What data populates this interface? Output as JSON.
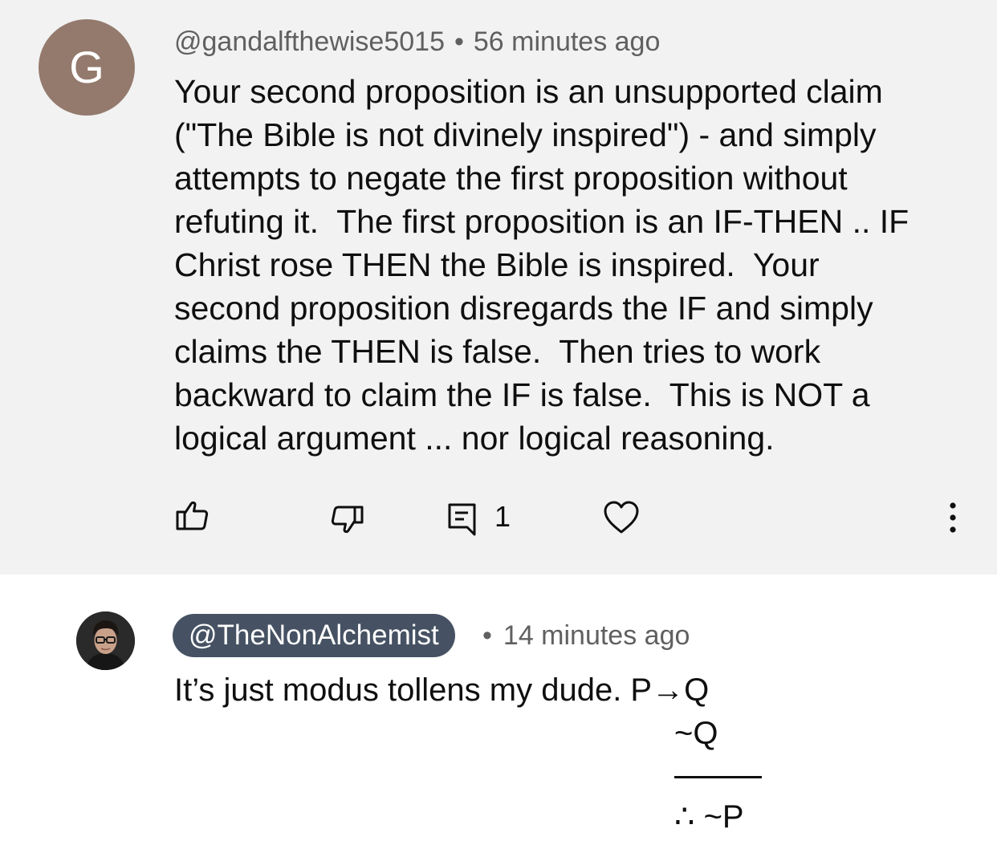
{
  "main_comment": {
    "avatar_letter": "G",
    "author": "@gandalfthewise5015",
    "separator": "•",
    "timestamp": "56 minutes ago",
    "text_lines": [
      "Your second proposition is an unsupported claim",
      "(\"The Bible is not divinely inspired\") - and simply",
      "attempts to negate the first proposition without",
      "refuting it.  The first proposition is an IF-THEN .. IF",
      "Christ rose THEN the Bible is inspired.  Your",
      "second proposition disregards the IF and simply",
      "claims the THEN is false.  Then tries to work",
      "backward to claim the IF is false.  This is NOT a",
      "logical argument ... nor logical reasoning."
    ],
    "actions": {
      "reply_count": "1",
      "like_icon": "thumbs-up-icon",
      "dislike_icon": "thumbs-down-icon",
      "reply_icon": "comment-icon",
      "heart_icon": "heart-icon",
      "more_icon": "more-vertical-icon"
    },
    "avatar_color": "#937a6d",
    "background_color": "#f2f2f2"
  },
  "reply": {
    "author": "@TheNonAlchemist",
    "separator": "•",
    "timestamp": "14 minutes ago",
    "text": "It’s just modus tollens my dude. P→Q",
    "premise_2": "~Q",
    "conclusion": "∴ ~P",
    "author_pill_color": "#465263"
  }
}
